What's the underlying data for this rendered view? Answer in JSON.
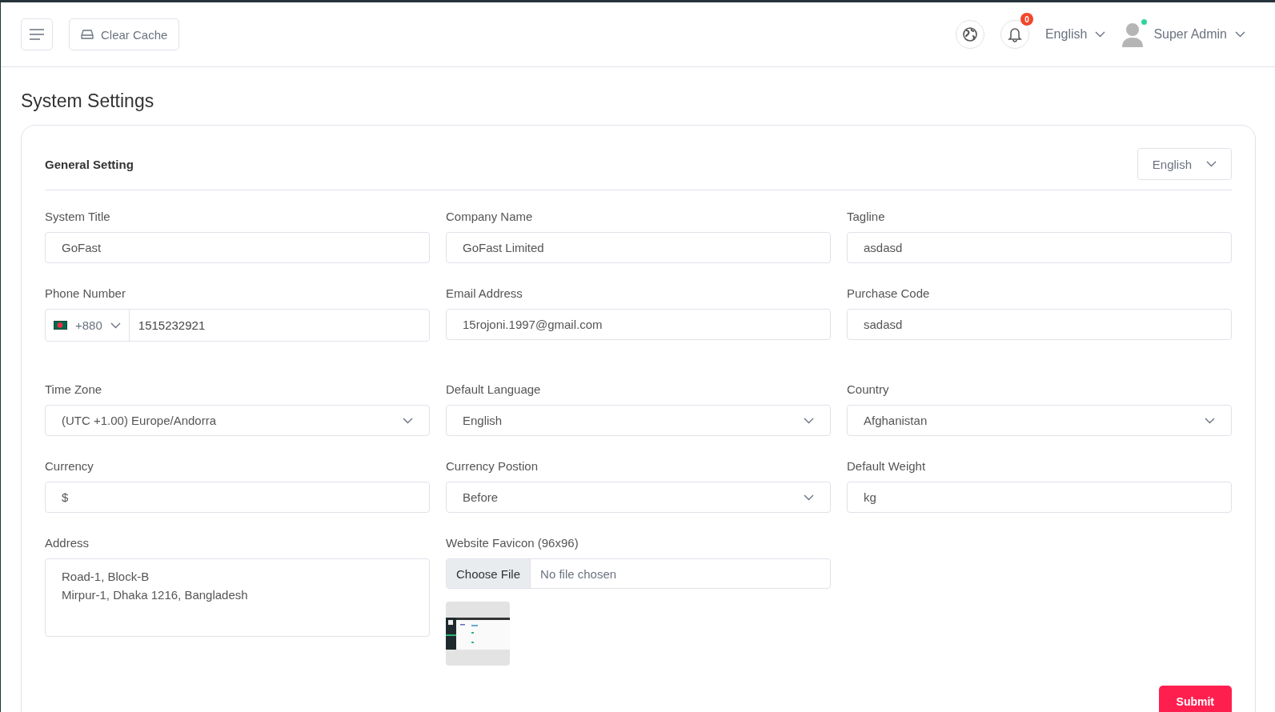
{
  "header": {
    "clear_cache": "Clear Cache",
    "notification_count": "0",
    "language": "English",
    "user": {
      "name": "Super Admin",
      "online": true
    }
  },
  "page_title": "System Settings",
  "card": {
    "title": "General Setting",
    "language": "English",
    "fields": [
      {
        "kind": "text",
        "label": "System Title",
        "value": "GoFast"
      },
      {
        "kind": "text",
        "label": "Company Name",
        "value": "GoFast Limited"
      },
      {
        "kind": "text",
        "label": "Tagline",
        "value": "asdasd"
      },
      {
        "kind": "phone",
        "label": "Phone Number",
        "dial_code": "+880",
        "value": "1515232921"
      },
      {
        "kind": "text",
        "label": "Email Address",
        "value": "15rojoni.1997@gmail.com"
      },
      {
        "kind": "text",
        "label": "Purchase Code",
        "value": "sadasd"
      },
      {
        "kind": "select",
        "label": "Time Zone",
        "value": "(UTC +1.00) Europe/Andorra"
      },
      {
        "kind": "select",
        "label": "Default Language",
        "value": "English"
      },
      {
        "kind": "select",
        "label": "Country",
        "value": "Afghanistan"
      },
      {
        "kind": "text",
        "label": "Currency",
        "value": "$"
      },
      {
        "kind": "select",
        "label": "Currency Postion",
        "value": "Before"
      },
      {
        "kind": "text",
        "label": "Default Weight",
        "value": "kg"
      },
      {
        "kind": "textarea",
        "label": "Address",
        "value": "Road-1, Block-B\nMirpur-1, Dhaka 1216, Bangladesh"
      },
      {
        "kind": "file",
        "label": "Website Favicon (96x96)",
        "button": "Choose File",
        "status": "No file chosen"
      }
    ],
    "submit": "Submit"
  }
}
